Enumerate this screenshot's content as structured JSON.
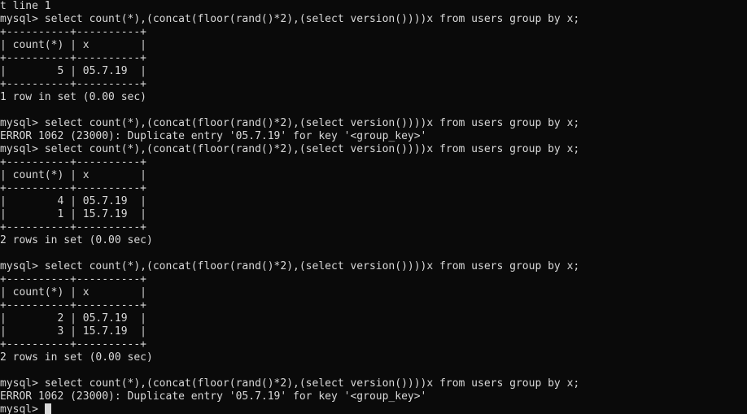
{
  "terminal": {
    "title": "mysql command line client",
    "background_color": "#0a0a0a",
    "foreground_color": "#d8d8d8",
    "prompt": "mysql>",
    "query": "mysql> select count(*),(concat(floor(rand()*2),(select version())))x from users group by x;",
    "error_line": "ERROR 1062 (23000): Duplicate entry '05.7.19' for key '<group_key>'",
    "separator": "+----------+----------+",
    "header_row": "| count(*) | x        |",
    "cursor_visible": true,
    "lines": [
      "t line 1",
      "mysql> select count(*),(concat(floor(rand()*2),(select version())))x from users group by x;",
      "+----------+----------+",
      "| count(*) | x        |",
      "+----------+----------+",
      "|        5 | 05.7.19  |",
      "+----------+----------+",
      "1 row in set (0.00 sec)",
      "",
      "mysql> select count(*),(concat(floor(rand()*2),(select version())))x from users group by x;",
      "ERROR 1062 (23000): Duplicate entry '05.7.19' for key '<group_key>'",
      "mysql> select count(*),(concat(floor(rand()*2),(select version())))x from users group by x;",
      "+----------+----------+",
      "| count(*) | x        |",
      "+----------+----------+",
      "|        4 | 05.7.19  |",
      "|        1 | 15.7.19  |",
      "+----------+----------+",
      "2 rows in set (0.00 sec)",
      "",
      "mysql> select count(*),(concat(floor(rand()*2),(select version())))x from users group by x;",
      "+----------+----------+",
      "| count(*) | x        |",
      "+----------+----------+",
      "|        2 | 05.7.19  |",
      "|        3 | 15.7.19  |",
      "+----------+----------+",
      "2 rows in set (0.00 sec)",
      "",
      "mysql> select count(*),(concat(floor(rand()*2),(select version())))x from users group by x;",
      "ERROR 1062 (23000): Duplicate entry '05.7.19' for key '<group_key>'",
      "mysql> "
    ],
    "results": [
      {
        "columns": [
          "count(*)",
          "x"
        ],
        "rows": [
          [
            "5",
            "05.7.19"
          ]
        ],
        "status": "1 row in set (0.00 sec)"
      },
      {
        "columns": [
          "count(*)",
          "x"
        ],
        "rows": [
          [
            "4",
            "05.7.19"
          ],
          [
            "1",
            "15.7.19"
          ]
        ],
        "status": "2 rows in set (0.00 sec)"
      },
      {
        "columns": [
          "count(*)",
          "x"
        ],
        "rows": [
          [
            "2",
            "05.7.19"
          ],
          [
            "3",
            "15.7.19"
          ]
        ],
        "status": "2 rows in set (0.00 sec)"
      }
    ]
  }
}
